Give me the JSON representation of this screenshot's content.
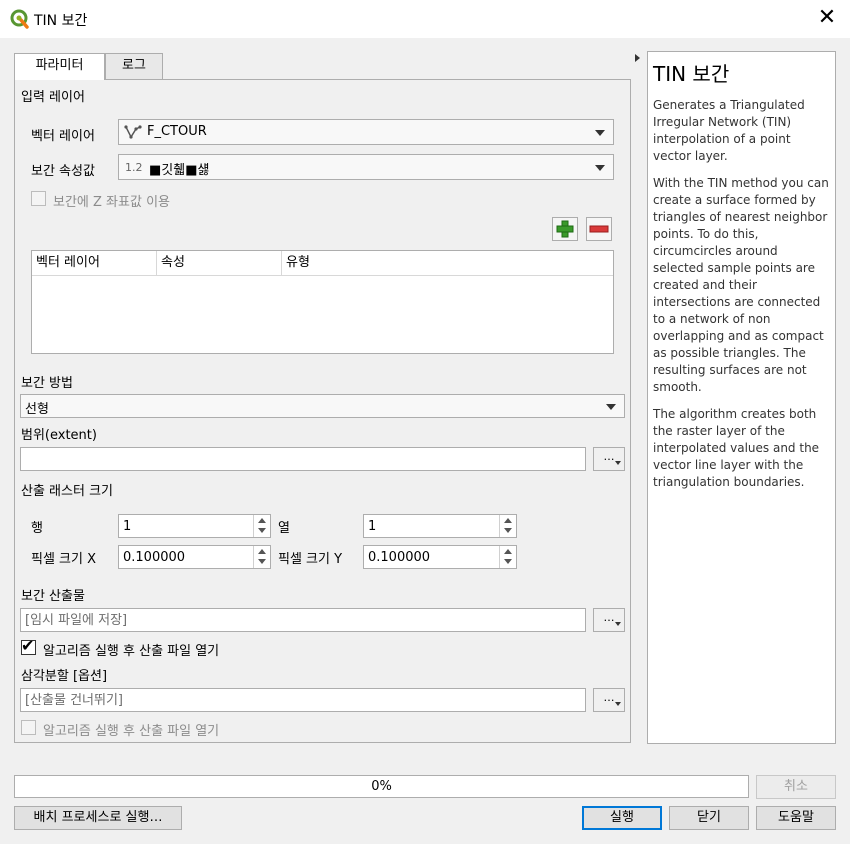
{
  "window": {
    "title": "TIN 보간",
    "close_glyph": "✕"
  },
  "tabs": [
    {
      "label": "파라미터",
      "active": true
    },
    {
      "label": "로그",
      "active": false
    }
  ],
  "input_section": {
    "title": "입력 레이어",
    "vector_layer_label": "벡터 레이어",
    "vector_layer_value": "F_CTOUR",
    "attribute_label": "보간 속성값",
    "attribute_prefix": "1.2",
    "attribute_value": "■깃췗■섏",
    "use_z_label": "보간에 Z 좌표값 이용",
    "use_z_checked": false
  },
  "layer_table": {
    "columns": [
      "벡터 레이어",
      "속성",
      "유형"
    ],
    "rows": []
  },
  "method": {
    "label": "보간 방법",
    "value": "선형"
  },
  "extent": {
    "label": "범위(extent)",
    "value": "",
    "browse_glyph": "…"
  },
  "raster_size": {
    "title": "산출 래스터 크기",
    "rows_label": "행",
    "rows_value": "1",
    "cols_label": "열",
    "cols_value": "1",
    "pixel_x_label": "픽셀 크기 X",
    "pixel_x_value": "0.100000",
    "pixel_y_label": "픽셀 크기 Y",
    "pixel_y_value": "0.100000"
  },
  "output": {
    "label": "보간 산출물",
    "placeholder": "[임시 파일에 저장]",
    "open_after_label": "알고리즘 실행 후 산출 파일 열기",
    "open_after_checked": true
  },
  "triangulation": {
    "label": "삼각분할 [옵션]",
    "placeholder": "[산출물 건너뛰기]",
    "open_after_label": "알고리즘 실행 후 산출 파일 열기",
    "open_after_checked": false
  },
  "help": {
    "title": "TIN 보간",
    "paragraphs": [
      "Generates a Triangulated Irregular Network (TIN) interpolation of a point vector layer.",
      "With the TIN method you can create a surface formed by triangles of nearest neighbor points. To do this, circumcircles around selected sample points are created and their intersections are connected to a network of non overlapping and as compact as possible triangles. The resulting surfaces are not smooth.",
      "The algorithm creates both the raster layer of the interpolated values and the vector line layer with the triangulation boundaries."
    ]
  },
  "progress": {
    "percent": 0,
    "text": "0%"
  },
  "buttons": {
    "cancel": "취소",
    "batch": "배치 프로세스로 실행…",
    "run": "실행",
    "close": "닫기",
    "help": "도움말"
  },
  "colors": {
    "accent": "#0078d7",
    "progress_fill": "#06b025",
    "add": "#3a9a2a",
    "remove": "#d93a3a"
  }
}
